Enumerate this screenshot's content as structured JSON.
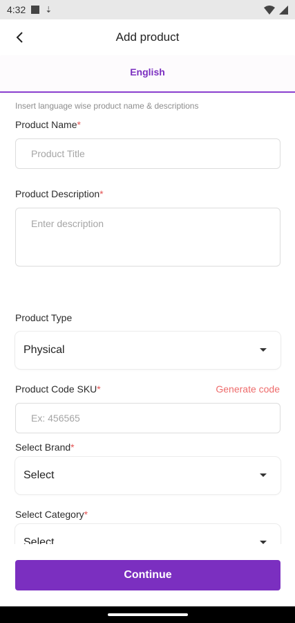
{
  "status_bar": {
    "time": "4:32",
    "icons": [
      "notification-square-icon",
      "download-arrow-icon",
      "wifi-icon",
      "signal-icon"
    ]
  },
  "app_bar": {
    "title": "Add product",
    "back_icon": "chevron-left-icon"
  },
  "tabs": [
    {
      "label": "English",
      "active": true
    }
  ],
  "form": {
    "hint": "Insert language wise product name & descriptions",
    "required_mark": "*",
    "product_name": {
      "label": "Product Name",
      "placeholder": "Product Title"
    },
    "product_description": {
      "label": "Product Description",
      "placeholder": "Enter description"
    },
    "product_type": {
      "label": "Product Type",
      "value": "Physical"
    },
    "product_code": {
      "label": "Product Code SKU",
      "placeholder": "Ex: 456565",
      "generate_label": "Generate code"
    },
    "brand": {
      "label": "Select Brand",
      "value": "Select"
    },
    "category": {
      "label": "Select Category",
      "value": "Select"
    }
  },
  "footer": {
    "continue_label": "Continue"
  },
  "colors": {
    "accent": "#7b2fc0",
    "required": "#e35454",
    "generate": "#ee6b6b"
  }
}
